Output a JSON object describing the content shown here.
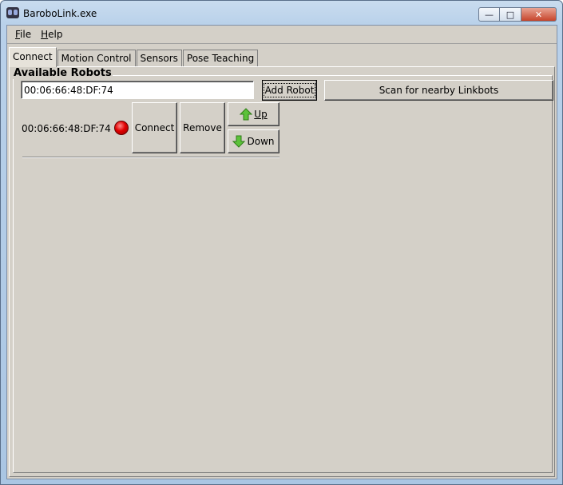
{
  "window": {
    "title": "BaroboLink.exe",
    "minimize_label": "—",
    "maximize_label": "□",
    "close_label": "✕"
  },
  "menu": [
    {
      "label": "File",
      "mnemonic": "F",
      "rest": "ile"
    },
    {
      "label": "Help",
      "mnemonic": "H",
      "rest": "elp"
    }
  ],
  "tabs": [
    "Connect",
    "Motion Control",
    "Sensors",
    "Pose Teaching"
  ],
  "active_tab": "Connect",
  "connect": {
    "group_title": "Available Robots",
    "address_input": "00:06:66:48:DF:74",
    "add_robot_label": "Add Robot",
    "scan_label": "Scan for nearby Linkbots",
    "robots": [
      {
        "address": "00:06:66:48:DF:74",
        "status": "disconnected",
        "status_color": "#e00000",
        "connect_label": "Connect",
        "remove_label": "Remove",
        "up_label": "Up",
        "down_label": "Down"
      }
    ]
  },
  "icons": {
    "app": "app-icon",
    "up": "green-up-arrow-icon",
    "down": "green-down-arrow-icon",
    "status": "red-led-icon"
  }
}
